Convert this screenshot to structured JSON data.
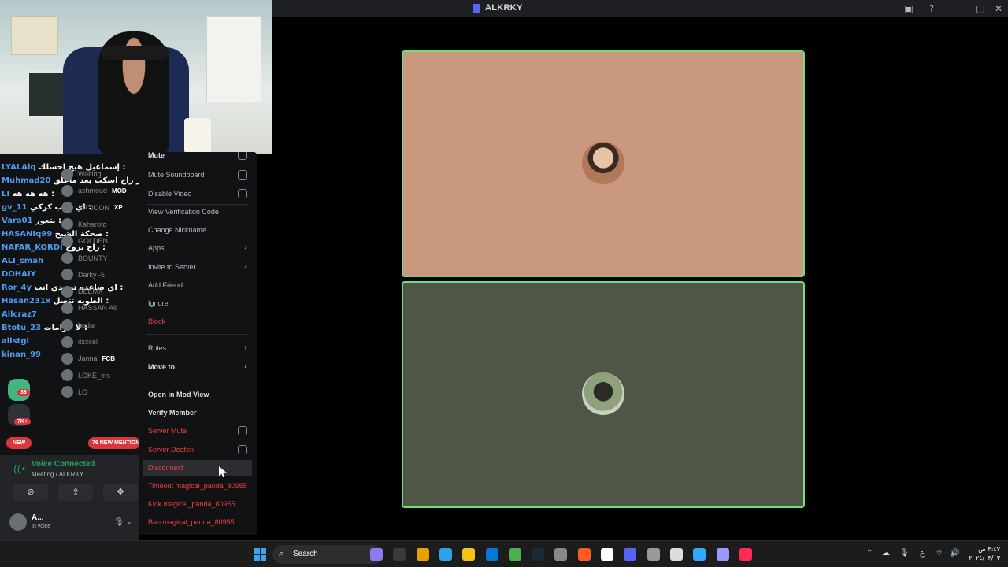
{
  "window": {
    "title": "ALKRKY",
    "inbox_icon": "inbox-icon",
    "help_icon": "help-icon",
    "controls": [
      "minimize-icon",
      "maximize-icon",
      "close-icon"
    ]
  },
  "stage": {
    "tile_border_color": "#6ee07a",
    "tiles": [
      {
        "bg": "#c9987f"
      },
      {
        "bg": "#4f5645"
      }
    ]
  },
  "chat_overlay": [
    {
      "user": "LYALAlq",
      "msg": "إسماعيل هيج احسلك :"
    },
    {
      "user": "Muhmad20",
      "msg": "حاضر راح اسكت بعد ماعلق :"
    },
    {
      "user": "LI",
      "msg": "هه هه هه :"
    },
    {
      "user": "gv_11",
      "msg": "اي ذايب كركي :"
    },
    {
      "user": "Vara01",
      "msg": "بتعور :"
    },
    {
      "user": "HASANIq99",
      "msg": "ضحكة الشيخ :"
    },
    {
      "user": "NAFAR_KORDI",
      "msg": "راح نروح :"
    },
    {
      "user": "ALI_smah",
      "msg": ""
    },
    {
      "user": "DOHAIY",
      "msg": ""
    },
    {
      "user": "Ror_4y",
      "msg": "اي صاعده تصيدي انت :"
    },
    {
      "user": "Hasan231x",
      "msg": "الطويه تتصل :"
    },
    {
      "user": "Allcraz7",
      "msg": ""
    },
    {
      "user": "Btotu_23",
      "msg": "لا حرامات :"
    },
    {
      "user": "alistgi",
      "msg": ""
    },
    {
      "user": "kinan_99",
      "msg": ""
    }
  ],
  "members": [
    {
      "name": "Waiting",
      "tag": ""
    },
    {
      "name": "ashmoud",
      "tag": "MOD"
    },
    {
      "name": "XP`JOON",
      "tag": "XP"
    },
    {
      "name": "Kaharoto",
      "tag": ""
    },
    {
      "name": "GOLDEN",
      "tag": ""
    },
    {
      "name": "BOUNTY",
      "tag": ""
    },
    {
      "name": "Darky -5",
      "tag": ""
    },
    {
      "name": "DEEMX_",
      "tag": ""
    },
    {
      "name": "HASSAN Ali",
      "tag": ""
    },
    {
      "name": "hedar",
      "tag": ""
    },
    {
      "name": "itsxcel",
      "tag": ""
    },
    {
      "name": "Janna",
      "tag": "FCB"
    },
    {
      "name": "LOKE_ms",
      "tag": ""
    },
    {
      "name": "LO",
      "tag": ""
    }
  ],
  "server_badges": {
    "b1": "36",
    "b2": "7K+",
    "new": "NEW",
    "mentions": "76 NEW MENTION"
  },
  "voice": {
    "status": "Voice Connected",
    "channel": "Meeting / ALKRKY",
    "user_name": "A...",
    "user_sub": "In voice"
  },
  "context_menu": {
    "mute": "Mute",
    "mute_soundboard": "Mute Soundboard",
    "disable_video": "Disable Video",
    "view_verification_code": "View Verification Code",
    "change_nickname": "Change Nickname",
    "apps": "Apps",
    "invite_to_server": "Invite to Server",
    "add_friend": "Add Friend",
    "ignore": "Ignore",
    "block": "Block",
    "roles": "Roles",
    "move_to": "Move to",
    "open_in_mod_view": "Open in Mod View",
    "verify_member": "Verify Member",
    "server_mute": "Server Mute",
    "server_deafen": "Server Deafen",
    "disconnect": "Disconnect",
    "timeout": "Timeout magical_panda_80955",
    "kick": "Kick magical_panda_80955",
    "ban": "Ban magical_panda_80955"
  },
  "taskbar": {
    "search_label": "Search",
    "tray_lang": "ع",
    "clock_time": "٣:٤٧ ص",
    "clock_date": "٢٠٢٤/٠٣/٠٣",
    "app_colors": [
      "#8a7cf0",
      "#3a3a3a",
      "#e8a000",
      "#2aa3e8",
      "#f0c419",
      "#0078d4",
      "#4caf50",
      "#1b2838",
      "#888",
      "#ff5a1f",
      "#fff",
      "#5865f2",
      "#999",
      "#ddd",
      "#31a8ff",
      "#9999ff",
      "#fe2c55"
    ]
  }
}
